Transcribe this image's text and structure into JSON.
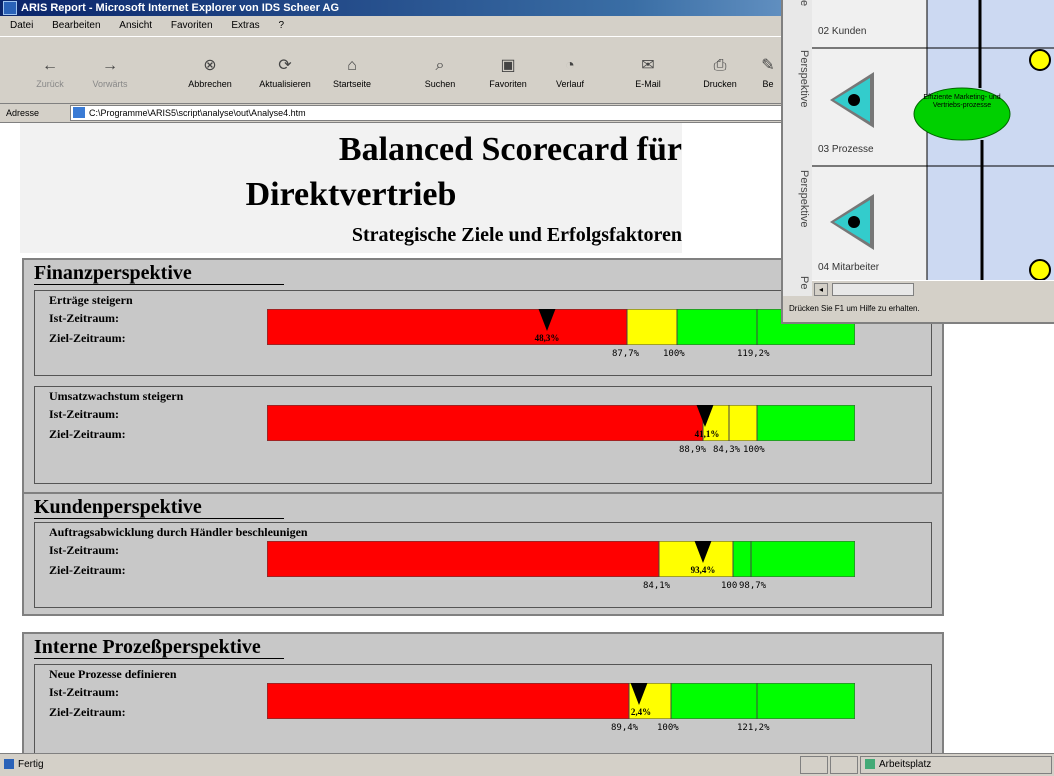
{
  "window": {
    "title": "ARIS Report - Microsoft Internet Explorer von IDS Scheer AG"
  },
  "menu": [
    "Datei",
    "Bearbeiten",
    "Ansicht",
    "Favoriten",
    "Extras",
    "?"
  ],
  "toolbar": {
    "back": "Zurück",
    "forward": "Vorwärts",
    "stop": "Abbrechen",
    "refresh": "Aktualisieren",
    "home": "Startseite",
    "search": "Suchen",
    "favorites": "Favoriten",
    "history": "Verlauf",
    "mail": "E-Mail",
    "print": "Drucken",
    "edit": "Be"
  },
  "address": {
    "label": "Adresse",
    "url": "C:\\Programme\\ARIS5\\script\\analyse\\out\\Analyse4.htm"
  },
  "status": {
    "text": "Fertig",
    "zone": "Arbeitsplatz"
  },
  "report": {
    "title1": "Balanced Scorecard für",
    "title2": "Direktvertrieb",
    "subtitle": "Strategische Ziele und Erfolgsfaktoren",
    "ist_label": "Ist-Zeitraum:",
    "ziel_label": "Ziel-Zeitraum:",
    "sections": [
      {
        "title": "Finanzperspektive"
      },
      {
        "title": "Kundenperspektive"
      },
      {
        "title": "Interne  Prozeßperspektive"
      }
    ],
    "goals": [
      {
        "name": "Erträge steigern",
        "value": "48,3%",
        "ticks": [
          "87,7%",
          "100%",
          "119,2%"
        ]
      },
      {
        "name": "Umsatzwachstum steigern",
        "value": "41,1%",
        "ticks": [
          "88,9%",
          "84,3%",
          "100%"
        ]
      },
      {
        "name": "Auftragsabwicklung durch Händler beschleunigen",
        "value": "93,4%",
        "ticks": [
          "84,1%",
          "100",
          "98,7%"
        ]
      },
      {
        "name": "Neue Prozesse definieren",
        "value": "2,4%",
        "ticks": [
          "89,4%",
          "100%",
          "121,2%"
        ]
      }
    ]
  },
  "aris": {
    "tab_labels": [
      "e",
      "Perspektive",
      "Perspektive",
      "Pe"
    ],
    "rows": [
      "02 Kunden",
      "03 Prozesse",
      "04 Mitarbeiter"
    ],
    "node_text": "Effiziente Marketing- und Vertriebs-prozesse",
    "status": "Drücken Sie F1 um Hilfe zu erhalten."
  },
  "colors": {
    "red": "#ff0000",
    "yellow": "#ffff00",
    "green": "#00ff00"
  }
}
